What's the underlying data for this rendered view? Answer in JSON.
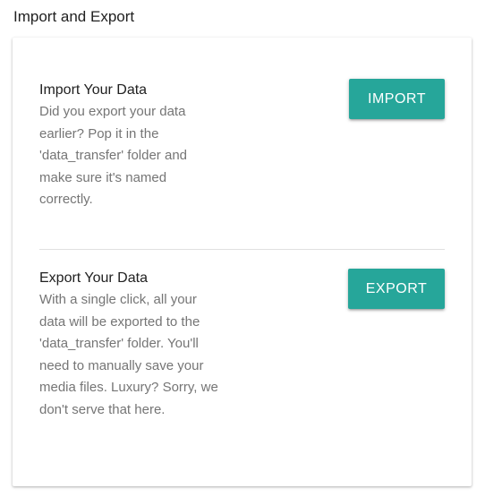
{
  "page": {
    "title": "Import and Export"
  },
  "import": {
    "title": "Import Your Data",
    "description": "Did you export your data earlier? Pop it in the 'data_transfer' folder and make sure it's named correctly.",
    "button_label": "IMPORT"
  },
  "export": {
    "title": "Export Your Data",
    "description": "With a single click, all your data will be exported to the 'data_transfer' folder. You'll need to manually save your media files. Luxury? Sorry, we don't serve that here.",
    "button_label": "EXPORT"
  },
  "colors": {
    "accent": "#26a69a",
    "title_text": "#212121",
    "secondary_text": "#757575",
    "divider": "#e0e0e0"
  }
}
